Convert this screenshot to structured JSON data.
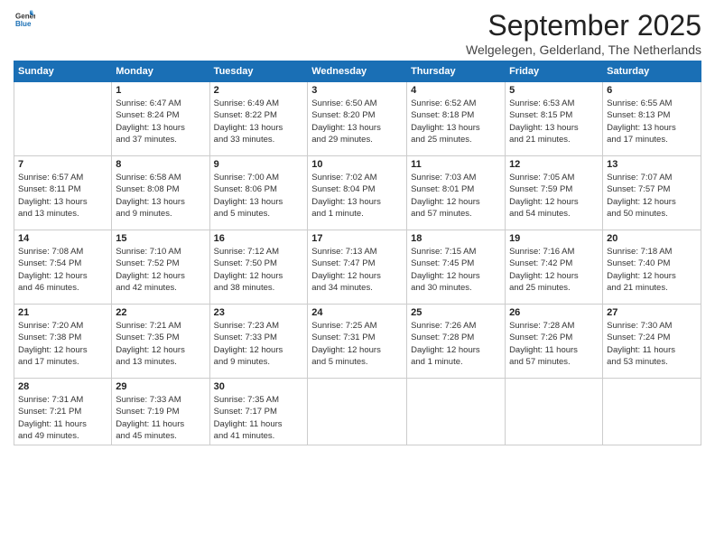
{
  "header": {
    "logo_general": "General",
    "logo_blue": "Blue",
    "month_year": "September 2025",
    "location": "Welgelegen, Gelderland, The Netherlands"
  },
  "days_of_week": [
    "Sunday",
    "Monday",
    "Tuesday",
    "Wednesday",
    "Thursday",
    "Friday",
    "Saturday"
  ],
  "weeks": [
    [
      {
        "day": "",
        "info": ""
      },
      {
        "day": "1",
        "info": "Sunrise: 6:47 AM\nSunset: 8:24 PM\nDaylight: 13 hours\nand 37 minutes."
      },
      {
        "day": "2",
        "info": "Sunrise: 6:49 AM\nSunset: 8:22 PM\nDaylight: 13 hours\nand 33 minutes."
      },
      {
        "day": "3",
        "info": "Sunrise: 6:50 AM\nSunset: 8:20 PM\nDaylight: 13 hours\nand 29 minutes."
      },
      {
        "day": "4",
        "info": "Sunrise: 6:52 AM\nSunset: 8:18 PM\nDaylight: 13 hours\nand 25 minutes."
      },
      {
        "day": "5",
        "info": "Sunrise: 6:53 AM\nSunset: 8:15 PM\nDaylight: 13 hours\nand 21 minutes."
      },
      {
        "day": "6",
        "info": "Sunrise: 6:55 AM\nSunset: 8:13 PM\nDaylight: 13 hours\nand 17 minutes."
      }
    ],
    [
      {
        "day": "7",
        "info": "Sunrise: 6:57 AM\nSunset: 8:11 PM\nDaylight: 13 hours\nand 13 minutes."
      },
      {
        "day": "8",
        "info": "Sunrise: 6:58 AM\nSunset: 8:08 PM\nDaylight: 13 hours\nand 9 minutes."
      },
      {
        "day": "9",
        "info": "Sunrise: 7:00 AM\nSunset: 8:06 PM\nDaylight: 13 hours\nand 5 minutes."
      },
      {
        "day": "10",
        "info": "Sunrise: 7:02 AM\nSunset: 8:04 PM\nDaylight: 13 hours\nand 1 minute."
      },
      {
        "day": "11",
        "info": "Sunrise: 7:03 AM\nSunset: 8:01 PM\nDaylight: 12 hours\nand 57 minutes."
      },
      {
        "day": "12",
        "info": "Sunrise: 7:05 AM\nSunset: 7:59 PM\nDaylight: 12 hours\nand 54 minutes."
      },
      {
        "day": "13",
        "info": "Sunrise: 7:07 AM\nSunset: 7:57 PM\nDaylight: 12 hours\nand 50 minutes."
      }
    ],
    [
      {
        "day": "14",
        "info": "Sunrise: 7:08 AM\nSunset: 7:54 PM\nDaylight: 12 hours\nand 46 minutes."
      },
      {
        "day": "15",
        "info": "Sunrise: 7:10 AM\nSunset: 7:52 PM\nDaylight: 12 hours\nand 42 minutes."
      },
      {
        "day": "16",
        "info": "Sunrise: 7:12 AM\nSunset: 7:50 PM\nDaylight: 12 hours\nand 38 minutes."
      },
      {
        "day": "17",
        "info": "Sunrise: 7:13 AM\nSunset: 7:47 PM\nDaylight: 12 hours\nand 34 minutes."
      },
      {
        "day": "18",
        "info": "Sunrise: 7:15 AM\nSunset: 7:45 PM\nDaylight: 12 hours\nand 30 minutes."
      },
      {
        "day": "19",
        "info": "Sunrise: 7:16 AM\nSunset: 7:42 PM\nDaylight: 12 hours\nand 25 minutes."
      },
      {
        "day": "20",
        "info": "Sunrise: 7:18 AM\nSunset: 7:40 PM\nDaylight: 12 hours\nand 21 minutes."
      }
    ],
    [
      {
        "day": "21",
        "info": "Sunrise: 7:20 AM\nSunset: 7:38 PM\nDaylight: 12 hours\nand 17 minutes."
      },
      {
        "day": "22",
        "info": "Sunrise: 7:21 AM\nSunset: 7:35 PM\nDaylight: 12 hours\nand 13 minutes."
      },
      {
        "day": "23",
        "info": "Sunrise: 7:23 AM\nSunset: 7:33 PM\nDaylight: 12 hours\nand 9 minutes."
      },
      {
        "day": "24",
        "info": "Sunrise: 7:25 AM\nSunset: 7:31 PM\nDaylight: 12 hours\nand 5 minutes."
      },
      {
        "day": "25",
        "info": "Sunrise: 7:26 AM\nSunset: 7:28 PM\nDaylight: 12 hours\nand 1 minute."
      },
      {
        "day": "26",
        "info": "Sunrise: 7:28 AM\nSunset: 7:26 PM\nDaylight: 11 hours\nand 57 minutes."
      },
      {
        "day": "27",
        "info": "Sunrise: 7:30 AM\nSunset: 7:24 PM\nDaylight: 11 hours\nand 53 minutes."
      }
    ],
    [
      {
        "day": "28",
        "info": "Sunrise: 7:31 AM\nSunset: 7:21 PM\nDaylight: 11 hours\nand 49 minutes."
      },
      {
        "day": "29",
        "info": "Sunrise: 7:33 AM\nSunset: 7:19 PM\nDaylight: 11 hours\nand 45 minutes."
      },
      {
        "day": "30",
        "info": "Sunrise: 7:35 AM\nSunset: 7:17 PM\nDaylight: 11 hours\nand 41 minutes."
      },
      {
        "day": "",
        "info": ""
      },
      {
        "day": "",
        "info": ""
      },
      {
        "day": "",
        "info": ""
      },
      {
        "day": "",
        "info": ""
      }
    ]
  ]
}
